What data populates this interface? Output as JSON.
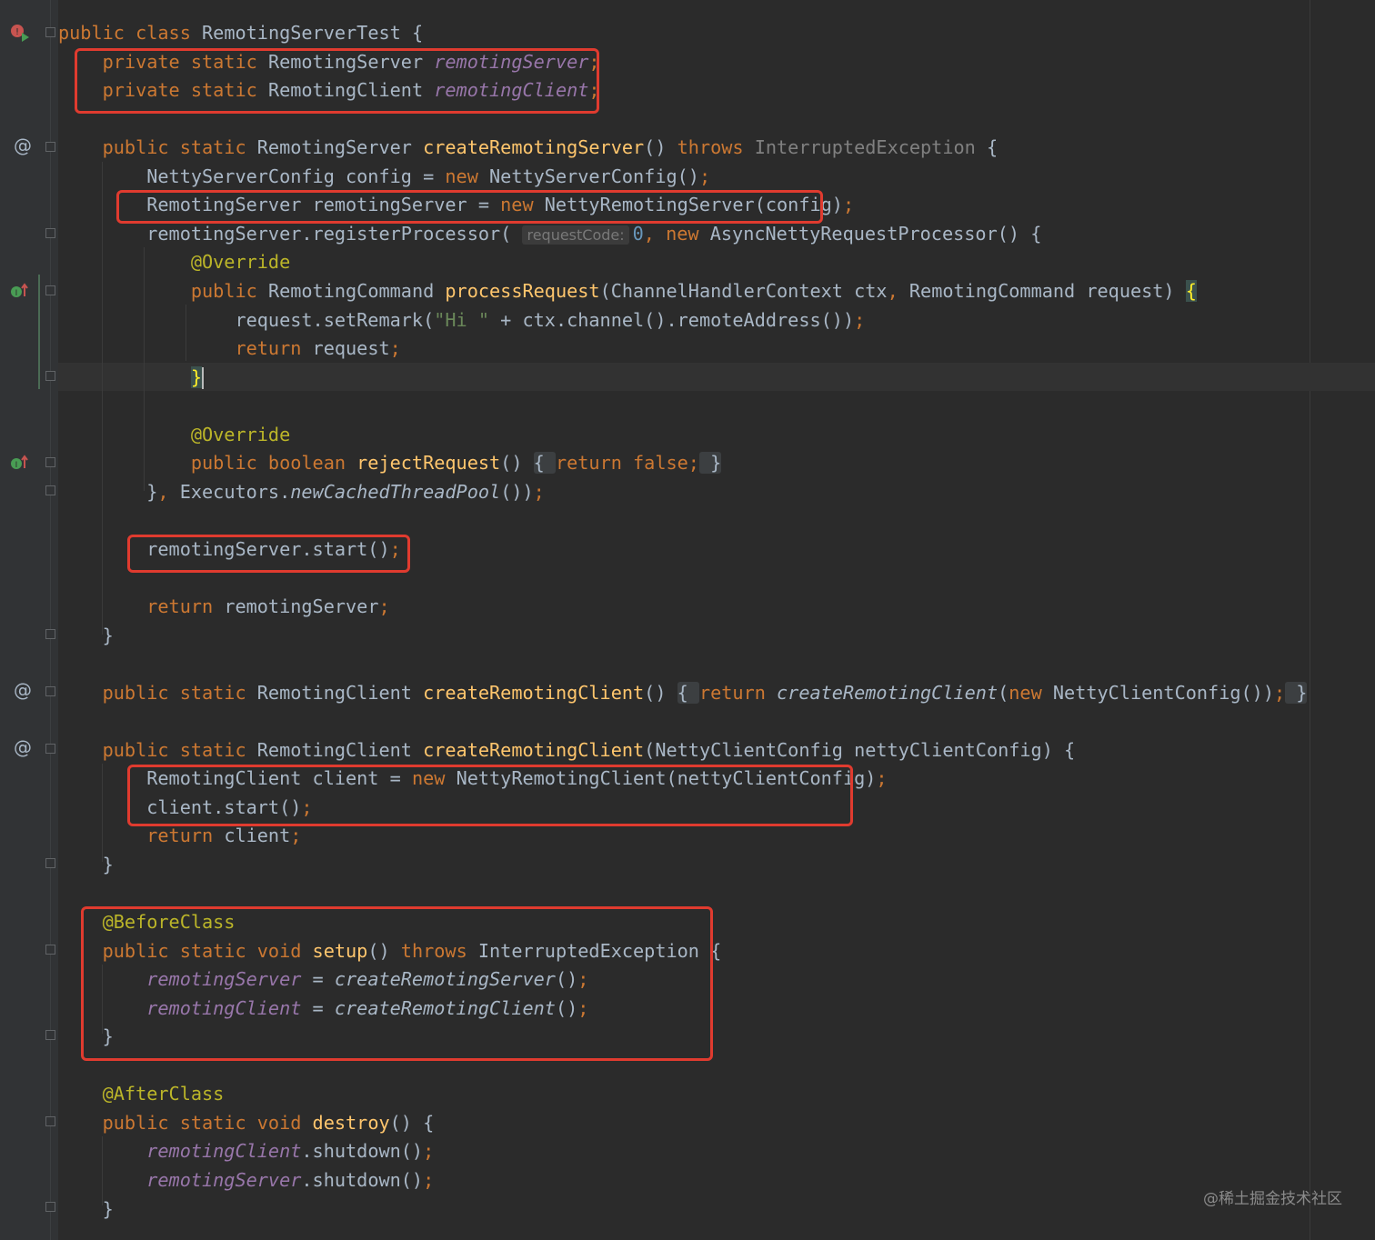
{
  "editor": {
    "lines": [
      [
        [
          "kw",
          "public class "
        ],
        [
          "plain",
          "RemotingServerTest {"
        ]
      ],
      [
        [
          "kw",
          "    private static "
        ],
        [
          "plain",
          "RemotingServer "
        ],
        [
          "field",
          "remotingServer"
        ],
        [
          "kw",
          ";"
        ]
      ],
      [
        [
          "kw",
          "    private static "
        ],
        [
          "plain",
          "RemotingClient "
        ],
        [
          "field",
          "remotingClient"
        ],
        [
          "kw",
          ";"
        ]
      ],
      [],
      [
        [
          "kw",
          "    public static "
        ],
        [
          "plain",
          "RemotingServer "
        ],
        [
          "fn",
          "createRemotingServer"
        ],
        [
          "plain",
          "() "
        ],
        [
          "kw",
          "throws "
        ],
        [
          "gray",
          "InterruptedException"
        ],
        [
          "plain",
          " {"
        ]
      ],
      [
        [
          "plain",
          "        NettyServerConfig config = "
        ],
        [
          "kw",
          "new "
        ],
        [
          "plain",
          "NettyServerConfig()"
        ],
        [
          "kw",
          ";"
        ]
      ],
      [
        [
          "plain",
          "        RemotingServer remotingServer = "
        ],
        [
          "kw",
          "new "
        ],
        [
          "plain",
          "NettyRemotingServer(config)"
        ],
        [
          "kw",
          ";"
        ]
      ],
      [
        [
          "plain",
          "        remotingServer.registerProcessor( "
        ],
        [
          "hint",
          "requestCode:"
        ],
        [
          "num",
          "0"
        ],
        [
          "kw",
          ", new "
        ],
        [
          "plain",
          "AsyncNettyRequestProcessor() {"
        ]
      ],
      [
        [
          "ann",
          "            @Override"
        ]
      ],
      [
        [
          "kw",
          "            public "
        ],
        [
          "plain",
          "RemotingCommand "
        ],
        [
          "fn",
          "processRequest"
        ],
        [
          "plain",
          "(ChannelHandlerContext ctx"
        ],
        [
          "kw",
          ", "
        ],
        [
          "plain",
          "RemotingCommand request) "
        ],
        [
          "brace",
          "{"
        ]
      ],
      [
        [
          "plain",
          "                request.setRemark("
        ],
        [
          "str",
          "\"Hi \""
        ],
        [
          "plain",
          " + ctx.channel().remoteAddress())"
        ],
        [
          "kw",
          ";"
        ]
      ],
      [
        [
          "kw",
          "                return "
        ],
        [
          "plain",
          "request"
        ],
        [
          "kw",
          ";"
        ]
      ],
      [
        [
          "plain",
          "            "
        ],
        [
          "brace",
          "}"
        ],
        [
          "caret",
          ""
        ]
      ],
      [],
      [
        [
          "ann",
          "            @Override"
        ]
      ],
      [
        [
          "kw",
          "            public boolean "
        ],
        [
          "fn",
          "rejectRequest"
        ],
        [
          "plain",
          "() "
        ],
        [
          "folded",
          "{ "
        ],
        [
          "kw",
          "return false;"
        ],
        [
          "folded",
          " }"
        ]
      ],
      [
        [
          "plain",
          "        }"
        ],
        [
          "kw",
          ", "
        ],
        [
          "plain",
          "Executors."
        ],
        [
          "ital",
          "newCachedThreadPool"
        ],
        [
          "plain",
          "())"
        ],
        [
          "kw",
          ";"
        ]
      ],
      [],
      [
        [
          "plain",
          "        remotingServer.start()"
        ],
        [
          "kw",
          ";"
        ]
      ],
      [],
      [
        [
          "kw",
          "        return "
        ],
        [
          "plain",
          "remotingServer"
        ],
        [
          "kw",
          ";"
        ]
      ],
      [
        [
          "plain",
          "    }"
        ]
      ],
      [],
      [
        [
          "kw",
          "    public static "
        ],
        [
          "plain",
          "RemotingClient "
        ],
        [
          "fn",
          "createRemotingClient"
        ],
        [
          "plain",
          "() "
        ],
        [
          "folded",
          "{ "
        ],
        [
          "kw",
          "return "
        ],
        [
          "ital",
          "createRemotingClient"
        ],
        [
          "plain",
          "("
        ],
        [
          "kw",
          "new "
        ],
        [
          "plain",
          "NettyClientConfig())"
        ],
        [
          "kw",
          ";"
        ],
        [
          "folded",
          " }"
        ]
      ],
      [],
      [
        [
          "kw",
          "    public static "
        ],
        [
          "plain",
          "RemotingClient "
        ],
        [
          "fn",
          "createRemotingClient"
        ],
        [
          "plain",
          "(NettyClientConfig nettyClientConfig) {"
        ]
      ],
      [
        [
          "plain",
          "        RemotingClient client = "
        ],
        [
          "kw",
          "new "
        ],
        [
          "plain",
          "NettyRemotingClient(nettyClientConfig)"
        ],
        [
          "kw",
          ";"
        ]
      ],
      [
        [
          "plain",
          "        client.start()"
        ],
        [
          "kw",
          ";"
        ]
      ],
      [
        [
          "kw",
          "        return "
        ],
        [
          "plain",
          "client"
        ],
        [
          "kw",
          ";"
        ]
      ],
      [
        [
          "plain",
          "    }"
        ]
      ],
      [],
      [
        [
          "ann",
          "    @BeforeClass"
        ]
      ],
      [
        [
          "kw",
          "    public static void "
        ],
        [
          "fn",
          "setup"
        ],
        [
          "plain",
          "() "
        ],
        [
          "kw",
          "throws "
        ],
        [
          "plain",
          "InterruptedException {"
        ]
      ],
      [
        [
          "field",
          "        remotingServer"
        ],
        [
          "plain",
          " = "
        ],
        [
          "ital",
          "createRemotingServer"
        ],
        [
          "plain",
          "()"
        ],
        [
          "kw",
          ";"
        ]
      ],
      [
        [
          "field",
          "        remotingClient"
        ],
        [
          "plain",
          " = "
        ],
        [
          "ital",
          "createRemotingClient"
        ],
        [
          "plain",
          "()"
        ],
        [
          "kw",
          ";"
        ]
      ],
      [
        [
          "plain",
          "    }"
        ]
      ],
      [],
      [
        [
          "ann",
          "    @AfterClass"
        ]
      ],
      [
        [
          "kw",
          "    public static void "
        ],
        [
          "fn",
          "destroy"
        ],
        [
          "plain",
          "() {"
        ]
      ],
      [
        [
          "field",
          "        remotingClient"
        ],
        [
          "plain",
          ".shutdown()"
        ],
        [
          "kw",
          ";"
        ]
      ],
      [
        [
          "field",
          "        remotingServer"
        ],
        [
          "plain",
          ".shutdown()"
        ],
        [
          "kw",
          ";"
        ]
      ],
      [
        [
          "plain",
          "    }"
        ]
      ]
    ]
  },
  "gutter": {
    "at_symbol": "@",
    "override_icon": "implements-method-icon",
    "run_icon": "run-test-icon"
  },
  "watermark": "@稀土掘金技术社区",
  "colors": {
    "background": "#2b2b2b",
    "gutter": "#313335",
    "keyword": "#cc7832",
    "annotation": "#bbb529",
    "field": "#9876aa",
    "method": "#ffc66d",
    "number": "#6897bb",
    "string": "#6a8759",
    "text": "#a9b7c6",
    "highlight_box": "#e03b2f"
  }
}
